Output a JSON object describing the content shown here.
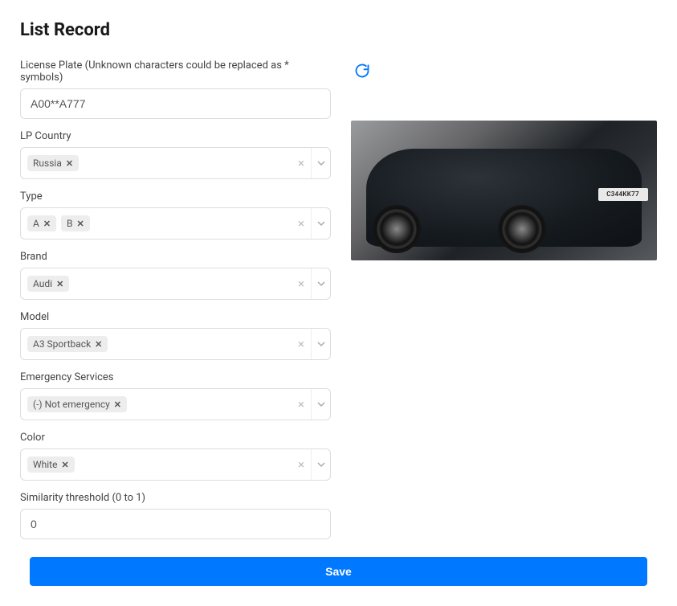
{
  "title": "List Record",
  "fields": {
    "license_plate": {
      "label": "License Plate (Unknown characters could be replaced as * symbols)",
      "value": "A00**A777"
    },
    "lp_country": {
      "label": "LP Country",
      "chips": [
        "Russia"
      ]
    },
    "type": {
      "label": "Type",
      "chips": [
        "A",
        "B"
      ]
    },
    "brand": {
      "label": "Brand",
      "chips": [
        "Audi"
      ]
    },
    "model": {
      "label": "Model",
      "chips": [
        "A3 Sportback"
      ]
    },
    "emergency": {
      "label": "Emergency Services",
      "chips": [
        "(-) Not emergency"
      ]
    },
    "color": {
      "label": "Color",
      "chips": [
        "White"
      ]
    },
    "similarity": {
      "label": "Similarity threshold (0 to 1)",
      "value": "0"
    }
  },
  "image_plate_text": "C344KK77",
  "save_label": "Save"
}
